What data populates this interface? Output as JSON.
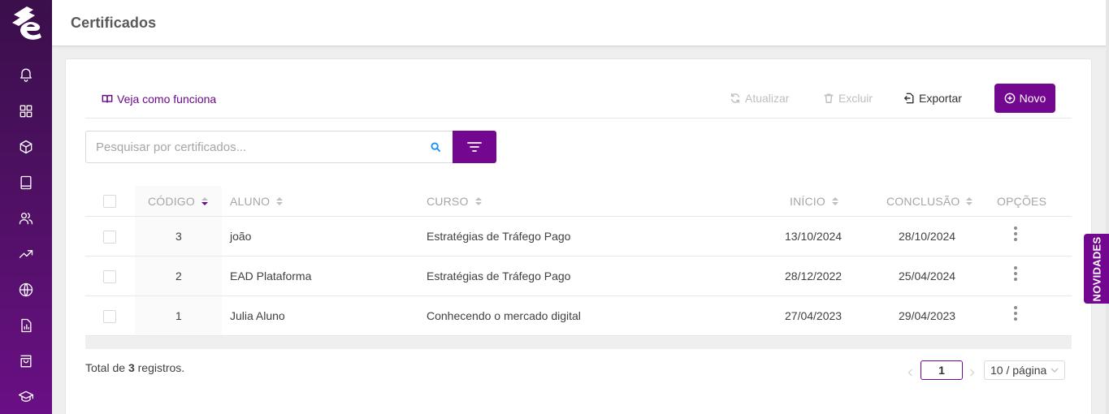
{
  "header": {
    "title": "Certificados"
  },
  "sidebar": {
    "items": [
      {
        "icon": "bell-icon"
      },
      {
        "icon": "grid-icon"
      },
      {
        "icon": "box-icon"
      },
      {
        "icon": "book-icon"
      },
      {
        "icon": "users-icon"
      },
      {
        "icon": "trending-icon"
      },
      {
        "icon": "globe-icon"
      },
      {
        "icon": "report-icon"
      },
      {
        "icon": "shopping-bag-icon"
      },
      {
        "icon": "graduation-cap-icon"
      }
    ]
  },
  "toolbar": {
    "how_label": "Veja como funciona",
    "refresh_label": "Atualizar",
    "delete_label": "Excluir",
    "export_label": "Exportar",
    "new_label": "Novo"
  },
  "search": {
    "placeholder": "Pesquisar por certificados...",
    "value": ""
  },
  "table": {
    "columns": [
      "CÓDIGO",
      "ALUNO",
      "CURSO",
      "INÍCIO",
      "CONCLUSÃO",
      "OPÇÕES"
    ],
    "rows": [
      {
        "code": "3",
        "student": "joão",
        "course": "Estratégias de Tráfego Pago",
        "start": "13/10/2024",
        "end": "28/10/2024"
      },
      {
        "code": "2",
        "student": "EAD Plataforma",
        "course": "Estratégias de Tráfego Pago",
        "start": "28/12/2022",
        "end": "25/04/2024"
      },
      {
        "code": "1",
        "student": "Julia Aluno",
        "course": "Conhecendo o mercado digital",
        "start": "27/04/2023",
        "end": "29/04/2023"
      }
    ]
  },
  "footer": {
    "total_prefix": "Total de ",
    "total_count": "3",
    "total_suffix": " registros.",
    "current_page": "1",
    "page_size": "10 / página"
  },
  "news_tab": {
    "label": "NOVIDADES"
  },
  "colors": {
    "accent": "#74078f",
    "sidebar": "#55106b",
    "search_icon": "#1890ff"
  }
}
